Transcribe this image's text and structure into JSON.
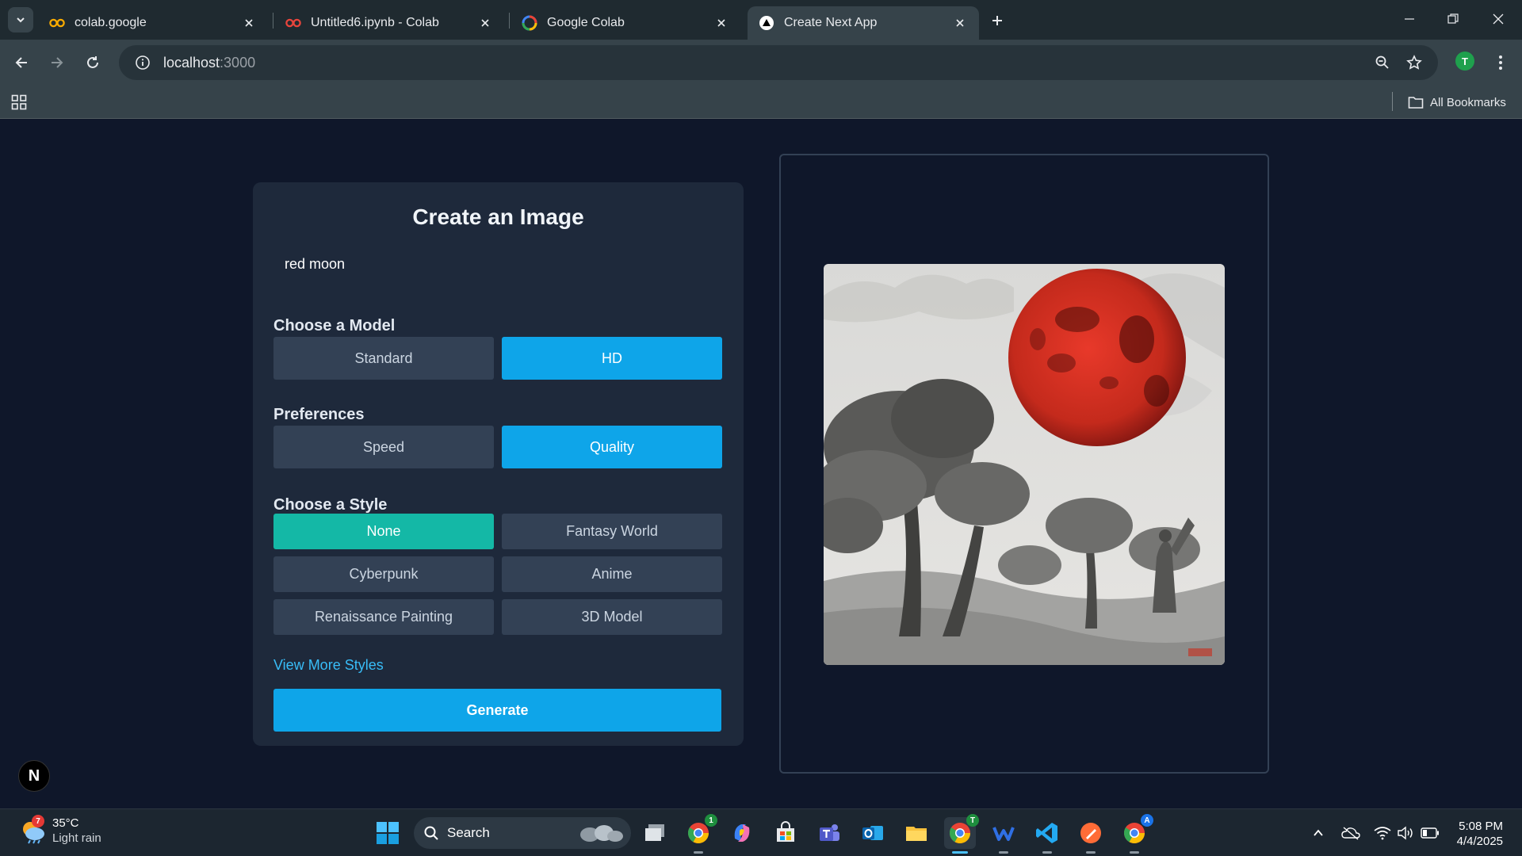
{
  "browser": {
    "tabs": [
      {
        "title": "colab.google",
        "icon": "colab-icon",
        "active": false
      },
      {
        "title": "Untitled6.ipynb - Colab",
        "icon": "colab-icon",
        "active": false
      },
      {
        "title": "Google Colab",
        "icon": "google-icon",
        "active": false
      },
      {
        "title": "Create Next App",
        "icon": "nextjs-icon",
        "active": true
      }
    ],
    "url_host": "localhost",
    "url_port": ":3000",
    "profile_initial": "T",
    "all_bookmarks_label": "All Bookmarks"
  },
  "app": {
    "title": "Create an Image",
    "prompt_value": "red moon",
    "model": {
      "label": "Choose a Model",
      "options": [
        "Standard",
        "HD"
      ],
      "selected": "HD"
    },
    "preferences": {
      "label": "Preferences",
      "options": [
        "Speed",
        "Quality"
      ],
      "selected": "Quality"
    },
    "style": {
      "label": "Choose a Style",
      "options": [
        "None",
        "Fantasy World",
        "Cyberpunk",
        "Anime",
        "Renaissance Painting",
        "3D Model"
      ],
      "selected": "None"
    },
    "view_more_label": "View More Styles",
    "generate_label": "Generate",
    "dev_badge_letter": "N"
  },
  "colors": {
    "accent": "#0ea5e9",
    "style_selected": "#14b8a6",
    "page_bg": "#0f172a",
    "card_bg": "#1e293b"
  },
  "taskbar": {
    "weather_temp": "35°C",
    "weather_condition": "Light rain",
    "weather_badge": "7",
    "search_label": "Search",
    "time": "5:08 PM",
    "date": "4/4/2025"
  }
}
